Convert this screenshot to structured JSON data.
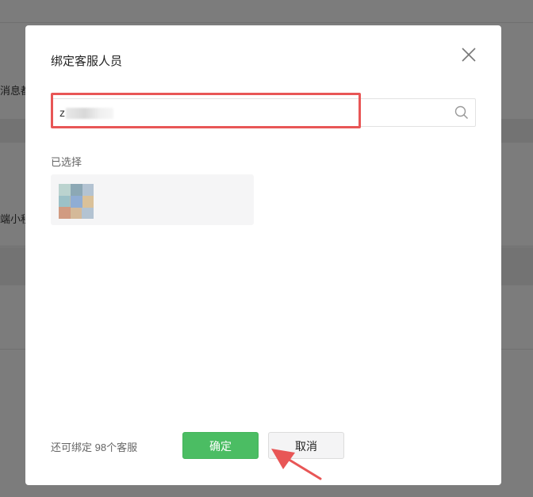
{
  "background": {
    "snippet_1": "消息都",
    "snippet_2": "端小程"
  },
  "dialog": {
    "title": "绑定客服人员",
    "search": {
      "value": "z",
      "placeholder": ""
    },
    "selected_label": "已选择",
    "selected_members": [
      {
        "name": "",
        "subtitle": ""
      }
    ],
    "quota_text": "还可绑定 98个客服",
    "confirm_label": "确定",
    "cancel_label": "取消"
  },
  "colors": {
    "highlight": "#e85656",
    "confirm": "#4bbd63",
    "arrow": "#e85656"
  }
}
